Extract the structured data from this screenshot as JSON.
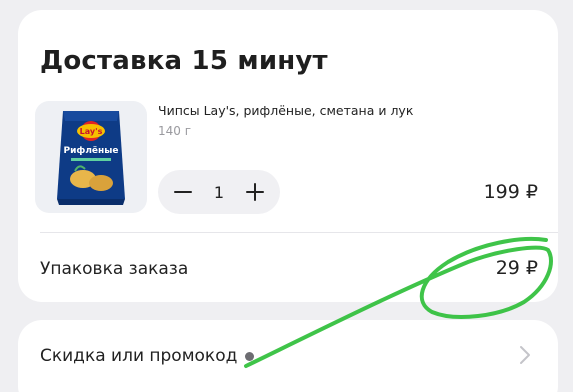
{
  "delivery": {
    "title": "Доставка 15 минут",
    "item": {
      "name": "Чипсы Lay's, рифлёные, сметана и лук",
      "weight": "140 г",
      "quantity": "1",
      "price": "199 ₽",
      "image_alt": "Lay's Рифлёные",
      "package_texts": {
        "brand": "Lay's",
        "line": "Рифлёные"
      }
    },
    "packaging": {
      "label": "Упаковка заказа",
      "price": "29 ₽"
    }
  },
  "promo": {
    "label": "Скидка или промокод"
  },
  "icons": {
    "minus": "minus-icon",
    "plus": "plus-icon",
    "dot": "status-dot-icon",
    "chevron": "chevron-right-icon"
  },
  "colors": {
    "background": "#efeff2",
    "card": "#ffffff",
    "stepper": "#f0f0f3",
    "muted_text": "#9a9a9f",
    "marker": "#2fbf3a",
    "package_blue": "#0e3b86"
  }
}
